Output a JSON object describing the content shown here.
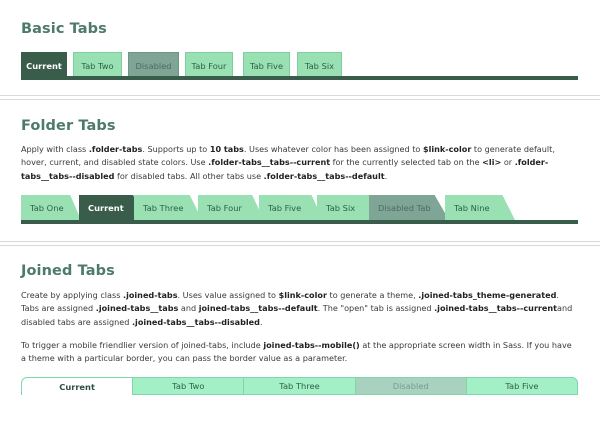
{
  "basic": {
    "title": "Basic Tabs",
    "tabs": [
      {
        "label": "Current",
        "state": "current"
      },
      {
        "label": "Tab Two",
        "state": "default"
      },
      {
        "label": "Disabled",
        "state": "disabled"
      },
      {
        "label": "Tab Four",
        "state": "default"
      },
      {
        "label": "Tab Five",
        "state": "default"
      },
      {
        "label": "Tab Six",
        "state": "default"
      }
    ]
  },
  "folder": {
    "title": "Folder Tabs",
    "desc": {
      "p1": "Apply with class ",
      "c1": ".folder-tabs",
      "p2": ". Supports up to ",
      "c2": "10 tabs",
      "p3": ". Uses whatever color has been assigned to ",
      "c3": "$link-color",
      "p4": " to generate default, hover, current, and disabled state colors. Use ",
      "c4": ".folder-tabs__tabs--current",
      "p5": " for the currently selected tab on the ",
      "c5": "<li>",
      "p6": " or ",
      "c6": ".folder-tabs__tabs--disabled",
      "p7": " for disabled tabs. All other tabs use ",
      "c7": ".folder-tabs__tabs--default",
      "p8": "."
    },
    "tabs": [
      {
        "label": "Tab One",
        "state": "default"
      },
      {
        "label": "Current",
        "state": "current"
      },
      {
        "label": "Tab Three",
        "state": "default"
      },
      {
        "label": "Tab Four",
        "state": "default"
      },
      {
        "label": "Tab Five",
        "state": "default"
      },
      {
        "label": "Tab Six",
        "state": "default"
      },
      {
        "label": "Disabled Tab",
        "state": "disabled"
      },
      {
        "label": "Tab Nine",
        "state": "default"
      }
    ]
  },
  "joined": {
    "title": "Joined Tabs",
    "desc1": {
      "p1": "Create by applying class ",
      "c1": ".joined-tabs",
      "p2": ". Uses value assigned to ",
      "c2": "$link-color",
      "p3": " to generate a theme, ",
      "c3": ".joined-tabs_theme-generated",
      "p4": ". Tabs are assigned ",
      "c4": ".joined-tabs__tabs",
      "p5": " and ",
      "c5": "joined-tabs__tabs--default",
      "p6": ". The \"open\" tab is assigned ",
      "c6": ".joined-tabs__tabs--current",
      "p7": "and disabled tabs are assigned ",
      "c7": ".joined-tabs__tabs--disabled",
      "p8": "."
    },
    "desc2": {
      "p1": "To trigger a mobile friendlier version of joined-tabs, include ",
      "c1": "joined-tabs--mobile()",
      "p2": " at the appropriate screen width in Sass. If you have a theme with a particular border, you can pass the border value as a parameter."
    },
    "tabs": [
      {
        "label": "Current",
        "state": "current"
      },
      {
        "label": "Tab Two",
        "state": "default"
      },
      {
        "label": "Tab Three",
        "state": "default"
      },
      {
        "label": "Disabled",
        "state": "disabled"
      },
      {
        "label": "Tab Five",
        "state": "default"
      }
    ]
  },
  "colors": {
    "accent_dark": "#3a5d4b",
    "tab_default": "#99e0b3",
    "tab_disabled": "#7fa596",
    "joined_default": "#a3f0c7",
    "heading": "#4d7a69"
  }
}
